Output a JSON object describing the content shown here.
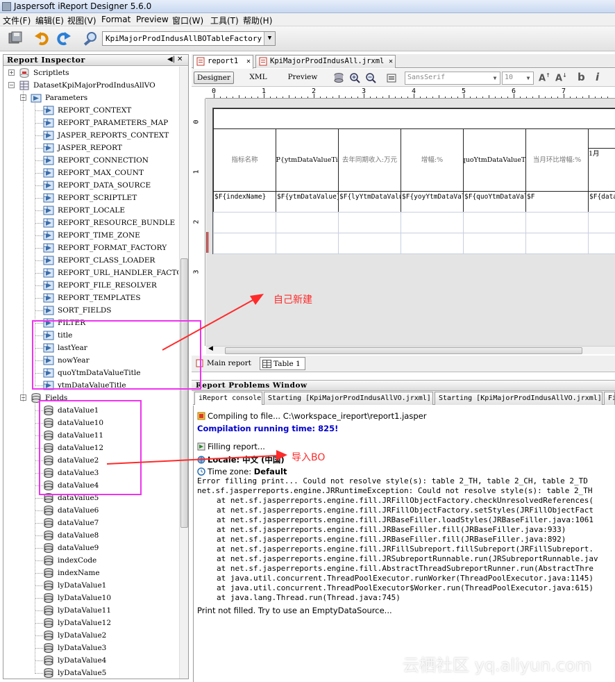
{
  "window": {
    "title": "Jaspersoft iReport Designer 5.6.0"
  },
  "menu": [
    "文件(F)",
    "编辑(E)",
    "视图(V)",
    "Format",
    "Preview",
    "窗口(W)",
    "工具(T)",
    "帮助(H)"
  ],
  "toolbar": {
    "datasource": "KpiMajorProdIndusAllBOTableFactory"
  },
  "inspector": {
    "title": "Report Inspector",
    "controls": [
      "◀|",
      "▶",
      "✕"
    ],
    "nodes": {
      "scriptlets": "Scriptlets",
      "dataset": "DatasetKpiMajorProdIndusAllVO",
      "parameters": "Parameters",
      "fields": "Fields"
    },
    "parameters": [
      "REPORT_CONTEXT",
      "REPORT_PARAMETERS_MAP",
      "JASPER_REPORTS_CONTEXT",
      "JASPER_REPORT",
      "REPORT_CONNECTION",
      "REPORT_MAX_COUNT",
      "REPORT_DATA_SOURCE",
      "REPORT_SCRIPTLET",
      "REPORT_LOCALE",
      "REPORT_RESOURCE_BUNDLE",
      "REPORT_TIME_ZONE",
      "REPORT_FORMAT_FACTORY",
      "REPORT_CLASS_LOADER",
      "REPORT_URL_HANDLER_FACTORY",
      "REPORT_FILE_RESOLVER",
      "REPORT_TEMPLATES",
      "SORT_FIELDS",
      "FILTER",
      "title",
      "lastYear",
      "nowYear",
      "quoYtmDataValueTitle",
      "ytmDataValueTitle"
    ],
    "fields": [
      "dataValue1",
      "dataValue10",
      "dataValue11",
      "dataValue12",
      "dataValue2",
      "dataValue3",
      "dataValue4",
      "dataValue5",
      "dataValue6",
      "dataValue7",
      "dataValue8",
      "dataValue9",
      "indexCode",
      "indexName",
      "lyDataValue1",
      "lyDataValue10",
      "lyDataValue11",
      "lyDataValue12",
      "lyDataValue2",
      "lyDataValue3",
      "lyDataValue4",
      "lyDataValue5"
    ]
  },
  "editor": {
    "tabs": [
      {
        "label": "report1",
        "active": true
      },
      {
        "label": "KpiMajorProdIndusAll.jrxml",
        "active": false
      }
    ],
    "modes": [
      "Designer",
      "XML",
      "Preview"
    ],
    "font": "SansSerif",
    "size": "10",
    "ruler_top": [
      "0",
      "1",
      "2",
      "3",
      "4",
      "5",
      "6",
      "7"
    ],
    "ruler_left": [
      "0",
      "1",
      "2",
      "3"
    ],
    "table": {
      "headers": [
        "指标名称",
        "$P{ytmDataValueTitl",
        "去年同期收入:万元",
        "增幅:%",
        "$P{quoYtmDataValueTitle}",
        "当月环比增幅:%",
        "1月"
      ],
      "cells": [
        "$F{indexName}",
        "$F{ytmDataValue}",
        "$F{lyYtmDataValue}",
        "$F{yoyYtmDataValue",
        "$F{quoYtmDataValue}",
        "$F",
        "$F{dataV"
      ]
    },
    "view_tabs": [
      "Main report",
      "Table 1"
    ]
  },
  "problems": {
    "title": "Report Problems Window",
    "tabs": [
      "iReport console",
      "Starting [KpiMajorProdIndusAllVO.jrxml]",
      "Starting [KpiMajorProdIndusAllVO.jrxml]",
      "Fi"
    ],
    "lines": {
      "compiling": "Compiling to file... C:\\workspace_ireport\\report1.jasper",
      "compile_time": "Compilation running time: 825!",
      "filling": "Filling report...",
      "locale": "Locale: 中文 (中国)",
      "timezone_label": "Time zone: ",
      "timezone_value": "Default",
      "error1": "Error filling print... Could not resolve style(s): table 2_TH, table 2_CH, table 2_TD",
      "error2": "net.sf.jasperreports.engine.JRRuntimeException: Could not resolve style(s): table 2_TH",
      "stack": [
        "at net.sf.jasperreports.engine.fill.JRFillObjectFactory.checkUnresolvedReferences(",
        "at net.sf.jasperreports.engine.fill.JRFillObjectFactory.setStyles(JRFillObjectFact",
        "at net.sf.jasperreports.engine.fill.JRBaseFiller.loadStyles(JRBaseFiller.java:1061",
        "at net.sf.jasperreports.engine.fill.JRBaseFiller.fill(JRBaseFiller.java:933)",
        "at net.sf.jasperreports.engine.fill.JRBaseFiller.fill(JRBaseFiller.java:892)",
        "at net.sf.jasperreports.engine.fill.JRFillSubreport.fillSubreport(JRFillSubreport.",
        "at net.sf.jasperreports.engine.fill.JRSubreportRunnable.run(JRSubreportRunnable.jav",
        "at net.sf.jasperreports.engine.fill.AbstractThreadSubreportRunner.run(AbstractThre",
        "at java.util.concurrent.ThreadPoolExecutor.runWorker(ThreadPoolExecutor.java:1145)",
        "at java.util.concurrent.ThreadPoolExecutor$Worker.run(ThreadPoolExecutor.java:615)",
        "at java.lang.Thread.run(Thread.java:745)"
      ],
      "not_filled": "Print not filled. Try to use an EmptyDataSource..."
    }
  },
  "annotations": {
    "self_created": "自己新建",
    "import_bo": "导入BO"
  },
  "watermark": "云栖社区 yq.aliyun.com",
  "colors": {
    "magenta": "#ee33ee",
    "red_arrow": "#ff2a2a",
    "compile_blue": "#0000cc"
  }
}
